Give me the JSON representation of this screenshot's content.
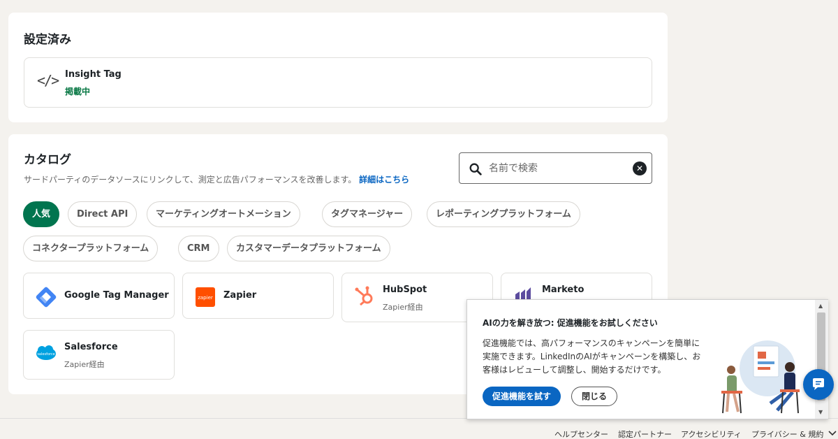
{
  "configured": {
    "title": "設定済み",
    "item": {
      "icon": "code-icon",
      "icon_glyph": "</>",
      "name": "Insight Tag",
      "status": "掲載中"
    }
  },
  "catalog": {
    "title": "カタログ",
    "description": "サードパーティのデータソースにリンクして、測定と広告パフォーマンスを改善します。",
    "description_link": "詳細はこちら",
    "search": {
      "placeholder": "名前で検索",
      "value": ""
    },
    "chips": [
      {
        "label": "人気",
        "active": true
      },
      {
        "label": "Direct API"
      },
      {
        "label": "マーケティングオートメーション"
      },
      {
        "label": "タグマネージャー"
      },
      {
        "label": "レポーティングプラットフォーム"
      },
      {
        "label": "コネクタープラットフォーム"
      },
      {
        "label": "CRM"
      },
      {
        "label": "カスタマーデータプラットフォーム"
      }
    ],
    "tiles": [
      {
        "name": "Google Tag Manager",
        "sub": "",
        "icon": "google-tag-manager-logo"
      },
      {
        "name": "Zapier",
        "sub": "",
        "icon": "zapier-logo",
        "logo_text": "zapier"
      },
      {
        "name": "HubSpot",
        "sub": "Zapier経由",
        "icon": "hubspot-logo"
      },
      {
        "name": "Marketo",
        "sub": "",
        "icon": "marketo-logo"
      },
      {
        "name": "Salesforce",
        "sub": "Zapier経由",
        "icon": "salesforce-logo",
        "logo_text": "salesforce"
      }
    ]
  },
  "popup": {
    "title": "AIの力を解き放つ: 促進機能をお試しください",
    "body": "促進機能では、高パフォーマンスのキャンペーンを簡単に実施できます。LinkedInのAIがキャンペーンを構築し、お客様はレビューして調整し、開始するだけです。",
    "primary_button": "促進機能を試す",
    "secondary_button": "閉じる"
  },
  "footer": {
    "links": [
      "ヘルプセンター",
      "認定パートナー",
      "アクセシビリティ",
      "プライバシー & 規約"
    ]
  },
  "colors": {
    "accent_green": "#01754f",
    "link_blue": "#0a66c2",
    "status_green": "#057642"
  }
}
